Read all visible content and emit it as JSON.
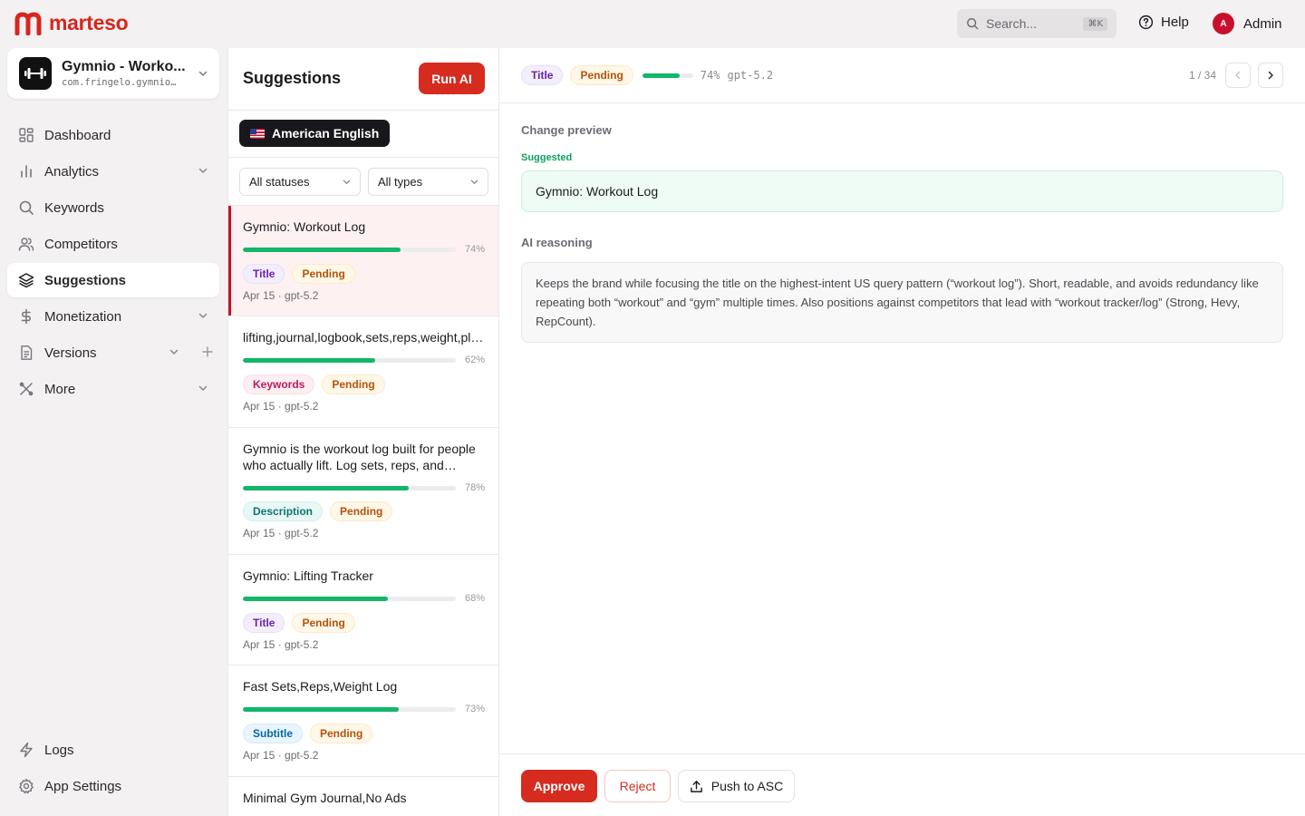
{
  "brand": {
    "name": "marteso",
    "color": "#d7261e"
  },
  "header": {
    "search_placeholder": "Search...",
    "search_shortcut": "⌘K",
    "help_label": "Help",
    "user_initial": "A",
    "user_name": "Admin"
  },
  "app": {
    "name": "Gymnio - Worko...",
    "bundle": "com.fringelo.gymnio…"
  },
  "sidebar": {
    "items": [
      {
        "label": "Dashboard",
        "icon": "grid-icon"
      },
      {
        "label": "Analytics",
        "icon": "bar-chart-icon",
        "expandable": true
      },
      {
        "label": "Keywords",
        "icon": "search-icon"
      },
      {
        "label": "Competitors",
        "icon": "users-icon"
      },
      {
        "label": "Suggestions",
        "icon": "layers-icon",
        "active": true
      },
      {
        "label": "Monetization",
        "icon": "dollar-icon",
        "expandable": true
      },
      {
        "label": "Versions",
        "icon": "file-icon",
        "expandable": true,
        "addable": true
      },
      {
        "label": "More",
        "icon": "tools-icon",
        "expandable": true
      }
    ],
    "bottom": [
      {
        "label": "Logs",
        "icon": "bolt-icon"
      },
      {
        "label": "App Settings",
        "icon": "settings-icon"
      }
    ]
  },
  "suggestions": {
    "title": "Suggestions",
    "run_ai_label": "Run AI",
    "locale": "American English",
    "status_filter": "All statuses",
    "type_filter": "All types",
    "items": [
      {
        "text": "Gymnio: Workout Log",
        "score": 74,
        "score_label": "74%",
        "type": "Title",
        "status": "Pending",
        "meta": "Apr 15 · gpt-5.2",
        "selected": true
      },
      {
        "text": "lifting,journal,logbook,sets,reps,weight,plate",
        "score": 62,
        "score_label": "62%",
        "type": "Keywords",
        "status": "Pending",
        "meta": "Apr 15 · gpt-5.2"
      },
      {
        "text": "Gymnio is the workout log built for people who actually lift. Log sets, reps, and weig...",
        "score": 78,
        "score_label": "78%",
        "type": "Description",
        "status": "Pending",
        "meta": "Apr 15 · gpt-5.2"
      },
      {
        "text": "Gymnio: Lifting Tracker",
        "score": 68,
        "score_label": "68%",
        "type": "Title",
        "status": "Pending",
        "meta": "Apr 15 · gpt-5.2"
      },
      {
        "text": "Fast Sets,Reps,Weight Log",
        "score": 73,
        "score_label": "73%",
        "type": "Subtitle",
        "status": "Pending",
        "meta": "Apr 15 · gpt-5.2"
      },
      {
        "text": "Minimal Gym Journal,No Ads"
      }
    ]
  },
  "detail": {
    "type": "Title",
    "status": "Pending",
    "score": 74,
    "score_label": "74%",
    "model": "gpt-5.2",
    "pager": "1 / 34",
    "change_preview_label": "Change preview",
    "suggested_label": "Suggested",
    "suggested_value": "Gymnio: Workout Log",
    "reasoning_label": "AI reasoning",
    "reasoning": "Keeps the brand while focusing the title on the highest-intent US query pattern (“workout log”). Short, readable, and avoids redundancy like repeating both “workout” and “gym” multiple times. Also positions against competitors that lead with “workout tracker/log” (Strong, Hevy, RepCount).",
    "approve_label": "Approve",
    "reject_label": "Reject",
    "push_label": "Push to ASC"
  }
}
